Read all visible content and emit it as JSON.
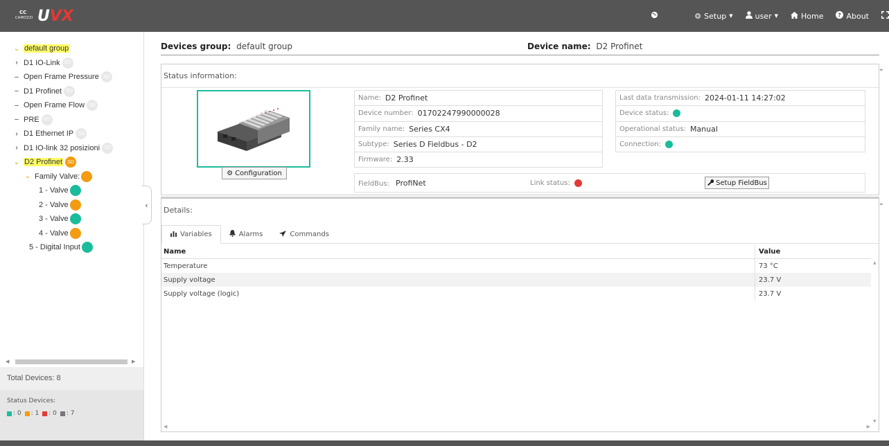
{
  "app": {
    "logo_text_u": "U",
    "logo_text_vx": "VX",
    "logo_brand": "CAMOZZI",
    "logo_brand_mark": "CC"
  },
  "topnav": {
    "setup": "Setup",
    "user": "user",
    "home": "Home",
    "about": "About"
  },
  "tree": {
    "root": "default group",
    "items": [
      {
        "label": "D1 IO-Link",
        "badge": "SD"
      },
      {
        "label": "Open Frame Pressure",
        "badge": "SD"
      },
      {
        "label": "D1 Profinet",
        "badge": "SD"
      },
      {
        "label": "Open Frame Flow",
        "badge": "SD"
      },
      {
        "label": "PRE",
        "badge": "SD"
      },
      {
        "label": "D1 Ethernet IP",
        "badge": "SD"
      },
      {
        "label": "D1 IO-link 32 posizioni",
        "badge": "SD"
      },
      {
        "label": "D2 Profinet",
        "badge": "SD"
      },
      {
        "label": "Family Valve:"
      },
      {
        "label": "1 - Valve"
      },
      {
        "label": "2 - Valve"
      },
      {
        "label": "3 - Valve"
      },
      {
        "label": "4 - Valve"
      },
      {
        "label": "5 - Digital Input"
      }
    ]
  },
  "sidebar": {
    "total_devices": "Total Devices: 8",
    "status_title": "Status Devices:",
    "status_counts": [
      {
        "count": ": 0",
        "color": "#1abc9c"
      },
      {
        "count": ": 1",
        "color": "#f39c12"
      },
      {
        "count": ": 0",
        "color": "#e53935"
      },
      {
        "count": ": 7",
        "color": "#777777"
      }
    ]
  },
  "header": {
    "group_label": "Devices group:",
    "group_value": "default group",
    "device_label": "Device name:",
    "device_value": "D2 Profinet"
  },
  "status_panel": {
    "title": "Status information:",
    "config_button": "Configuration",
    "left": [
      {
        "label": "Name:",
        "value": "D2 Profinet"
      },
      {
        "label": "Device number:",
        "value": "01702247990000028"
      },
      {
        "label": "Family name:",
        "value": "Series CX4"
      },
      {
        "label": "Subtype:",
        "value": "Series D Fieldbus - D2"
      },
      {
        "label": "Firmware:",
        "value": "2.33"
      }
    ],
    "right": [
      {
        "label": "Last data transmission:",
        "value": "2024-01-11 14:27:02"
      },
      {
        "label": "Device status:",
        "value": ""
      },
      {
        "label": "Operational status:",
        "value": "Manual"
      },
      {
        "label": "Connection:",
        "value": ""
      }
    ],
    "fieldbus_label": "FieldBus:",
    "fieldbus_value": "ProfiNet",
    "link_status_label": "Link status:",
    "setup_fieldbus_button": "Setup FieldBus"
  },
  "details_panel": {
    "title": "Details:",
    "tabs": [
      "Variables",
      "Alarms",
      "Commands"
    ],
    "columns": [
      "Name",
      "Value"
    ],
    "rows": [
      {
        "name": "Temperature",
        "value": "73 °C"
      },
      {
        "name": "Supply voltage",
        "value": "23.7 V"
      },
      {
        "name": "Supply voltage (logic)",
        "value": "23.7 V"
      }
    ]
  },
  "colors": {
    "topbar": "#555555",
    "ok": "#1abc9c",
    "warning": "#f39c12",
    "error": "#e53935",
    "highlight": "#ffff66"
  }
}
